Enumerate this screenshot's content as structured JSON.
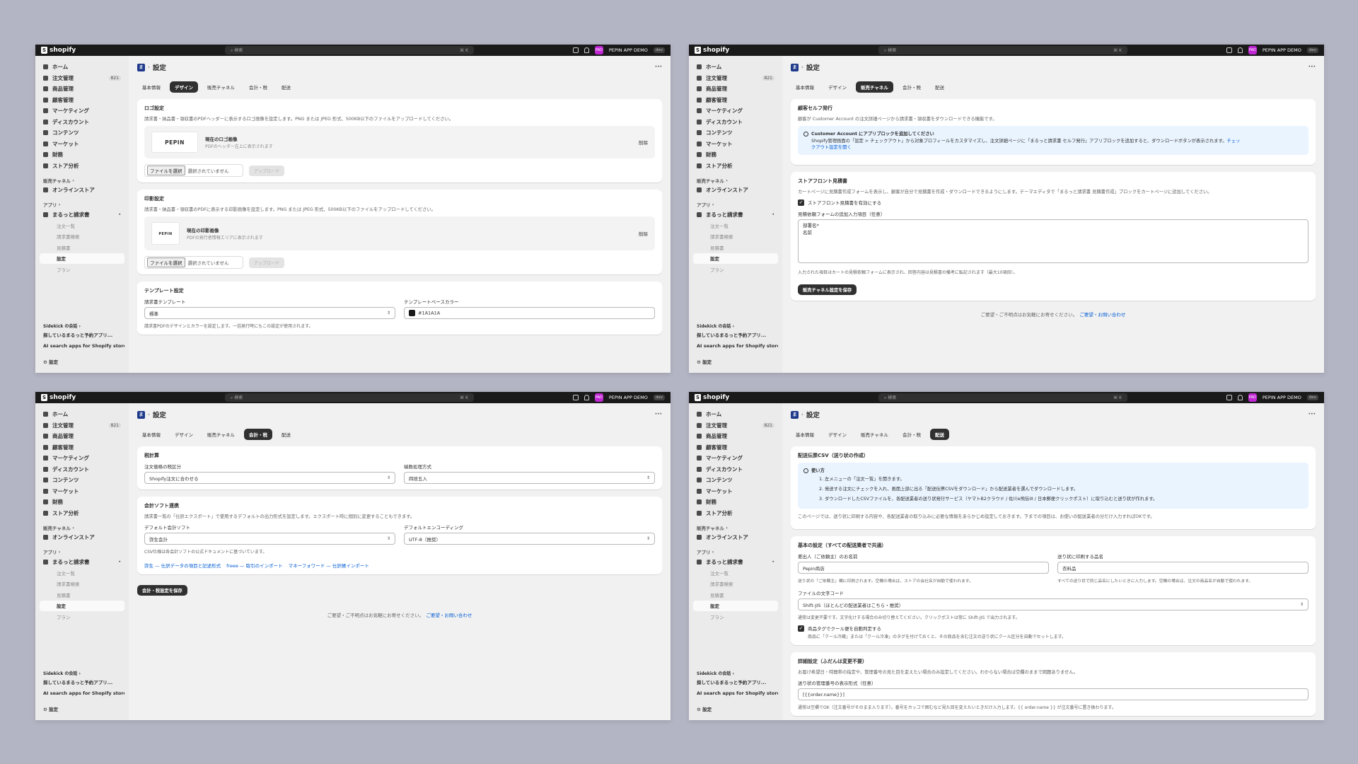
{
  "topbar": {
    "brand": "shopify",
    "search_placeholder": "検索",
    "shortcut": "⌘ K",
    "store": "PEPIN APP DEMO",
    "env": "dev",
    "avatar": "PAD"
  },
  "sidebar": {
    "items": [
      {
        "label": "ホーム"
      },
      {
        "label": "注文管理",
        "count": "821"
      },
      {
        "label": "商品管理"
      },
      {
        "label": "顧客管理"
      },
      {
        "label": "マーケティング"
      },
      {
        "label": "ディスカウント"
      },
      {
        "label": "コンテンツ"
      },
      {
        "label": "マーケット"
      },
      {
        "label": "財務"
      },
      {
        "label": "ストア分析"
      }
    ],
    "sales_channels": "販売チャネル",
    "online_store": "オンラインストア",
    "apps": "アプリ",
    "app_name": "まるっと請求書",
    "app_sub": [
      "注文一覧",
      "請求書検索",
      "見積書",
      "設定",
      "プラン"
    ],
    "sidekick": "Sidekick の会話",
    "conv1": "探しているまるっと予約アプリ...",
    "conv2": "AI search apps for Shopify store",
    "settings": "設定"
  },
  "page": {
    "title": "設定",
    "more": "···",
    "tabs": [
      "基本情報",
      "デザイン",
      "販売チャネル",
      "会計・税",
      "配送"
    ]
  },
  "design": {
    "logo": {
      "title": "ロゴ設定",
      "desc": "請求書・納品書・領収書のPDFヘッダーに表示するロゴ画像を設定します。PNG または JPEG 形式、500KB以下のファイルをアップロードしてください。",
      "img": "PEPIN",
      "current": "現在のロゴ画像",
      "sub": "PDFのヘッダー左上に表示されます",
      "delete": "削除",
      "choose": "ファイルを選択",
      "none": "選択されていません",
      "upload": "アップロード"
    },
    "seal": {
      "title": "印影設定",
      "desc": "請求書・納品書・領収書のPDFに表示する印影画像を設定します。PNG または JPEG 形式、500KB以下のファイルをアップロードしてください。",
      "img": "PEPIN",
      "current": "現在の印影画像",
      "sub": "PDFの発行者情報エリアに表示されます",
      "delete": "削除",
      "choose": "ファイルを選択",
      "none": "選択されていません",
      "upload": "アップロード"
    },
    "template": {
      "title": "テンプレート設定",
      "tpl_label": "請求書テンプレート",
      "tpl_value": "標準",
      "color_label": "テンプレートベースカラー",
      "color_value": "#1A1A1A",
      "hint": "請求書PDFのデザインとカラーを設定します。一括発行時にもこの設定が使用されます。"
    }
  },
  "channels": {
    "self": {
      "title": "顧客セルフ発行",
      "desc": "顧客が Customer Account の注文詳細ページから請求書・領収書をダウンロードできる機能です。",
      "info_title": "Customer Account にアプリブロックを追加してください",
      "info_body": "Shopify管理画面の「設定 > チェックアウト」から対象プロフィールをカスタマイズし、注文詳細ページに「まるっと請求書 セルフ発行」アプリブロックを追加すると、ダウンロードボタンが表示されます。",
      "info_link1": "チェッ",
      "info_link2": "クアウト設定を開く"
    },
    "storefront": {
      "title": "ストアフロント見積書",
      "desc": "カートページに見積書作成フォームを表示し、顧客が自分で見積書を作成・ダウンロードできるようにします。テーマエディタで「まるっと請求書 見積書作成」ブロックをカートページに追加してください。",
      "check": "ストアフロント見積書を有効にする",
      "field_label": "見積依頼フォームの追加入力項目（任意）",
      "field_lines": [
        "部署名*",
        "名前"
      ],
      "hint": "入力された項目はカートの見積依頼フォームに表示され、回答内容は見積書の備考に転記されます（最大10項目）。",
      "save": "販売チャネル設定を保存"
    },
    "footer": "ご要望・ご不明点はお気軽にお寄せください。",
    "footer_link": "ご要望・お問い合わせ"
  },
  "tax": {
    "calc": {
      "title": "税計算",
      "l1": "注文価格の税区分",
      "v1": "Shopify注文に合わせる",
      "l2": "端数処理方式",
      "v2": "四捨五入"
    },
    "acct": {
      "title": "会計ソフト連携",
      "desc": "請求書一覧の「仕訳エクスポート」で使用するデフォルトの出力形式を設定します。エクスポート時に個別に変更することもできます。",
      "l1": "デフォルト会計ソフト",
      "v1": "弥生会計",
      "l2": "デフォルトエンコーディング",
      "v2": "UTF-8（推奨）",
      "hint": "CSV仕様は各会計ソフトの公式ドキュメントに基づいています。",
      "links": [
        "弥生 — 仕訳データの項目と記述形式",
        "freee — 取引のインポート",
        "マネーフォワード — 仕訳帳インポート"
      ]
    },
    "save": "会計・税設定を保存",
    "footer": "ご要望・ご不明点はお気軽にお寄せください。",
    "footer_link": "ご要望・お問い合わせ"
  },
  "shipping": {
    "csv": {
      "title": "配送伝票CSV（送り状の作成）",
      "howto": "使い方",
      "steps": [
        "1. 左メニューの「注文一覧」を開きます。",
        "2. 発送する注文にチェックを入れ、画面上部に出る「配送伝票CSVをダウンロード」から配送業者を選んでダウンロードします。",
        "3. ダウンロードしたCSVファイルを、各配送業者の送り状発行サービス（ヤマトB2クラウド / 佐川e飛伝III / 日本郵便クリックポスト）に取り込むと送り状が作れます。"
      ],
      "note": "このページでは、送り状に印刷する内容や、各配送業者の取り込みに必要な情報をあらかじめ設定しておきます。下までの項目は、お使いの配送業者の分だけ入力すればOKです。"
    },
    "basic": {
      "title": "基本の設定（すべての配送業者で共通）",
      "sender_label": "差出人（ご依頼主）のお名前",
      "sender_value": "Pepin商店",
      "sender_hint": "送り状の「ご依頼主」欄に印刷されます。空欄の場合は、ストアの会社名が自動で使われます。",
      "item_label": "送り状に印刷する品名",
      "item_value": "衣料品",
      "item_hint": "すべての送り状で同じ品名にしたいときに入力します。空欄の場合は、注文の商品名が自動で使われます。",
      "enc_label": "ファイルの文字コード",
      "enc_value": "Shift-JIS（ほとんどの配送業者はこちら・推奨）",
      "enc_hint": "通常は変更不要です。文字化けする場合のみ切り替えてください。クリックポストは常に Shift-JIS で出力されます。",
      "cool_check": "商品タグでクール便を自動判定する",
      "cool_hint": "商品に「クール冷蔵」または「クール冷凍」のタグを付けておくと、その商品を含む注文の送り状にクール区分を自動でセットします。"
    },
    "adv": {
      "title": "詳細設定（ふだんは変更不要）",
      "desc": "お届け希望日・時間帯の指定や、管理番号の見た目を変えたい場合のみ設定してください。わからない場合は空欄のままで問題ありません。",
      "mgmt_label": "送り状の管理番号の表示形式（任意）",
      "mgmt_value": "[{{order.name}}]",
      "mgmt_hint": "通常は空欄でOK（注文番号がそのまま入ります）。番号をカッコで囲むなど見た目を変えたいときだけ入力します。{{ order.name }} が注文番号に置き換わります。"
    }
  }
}
